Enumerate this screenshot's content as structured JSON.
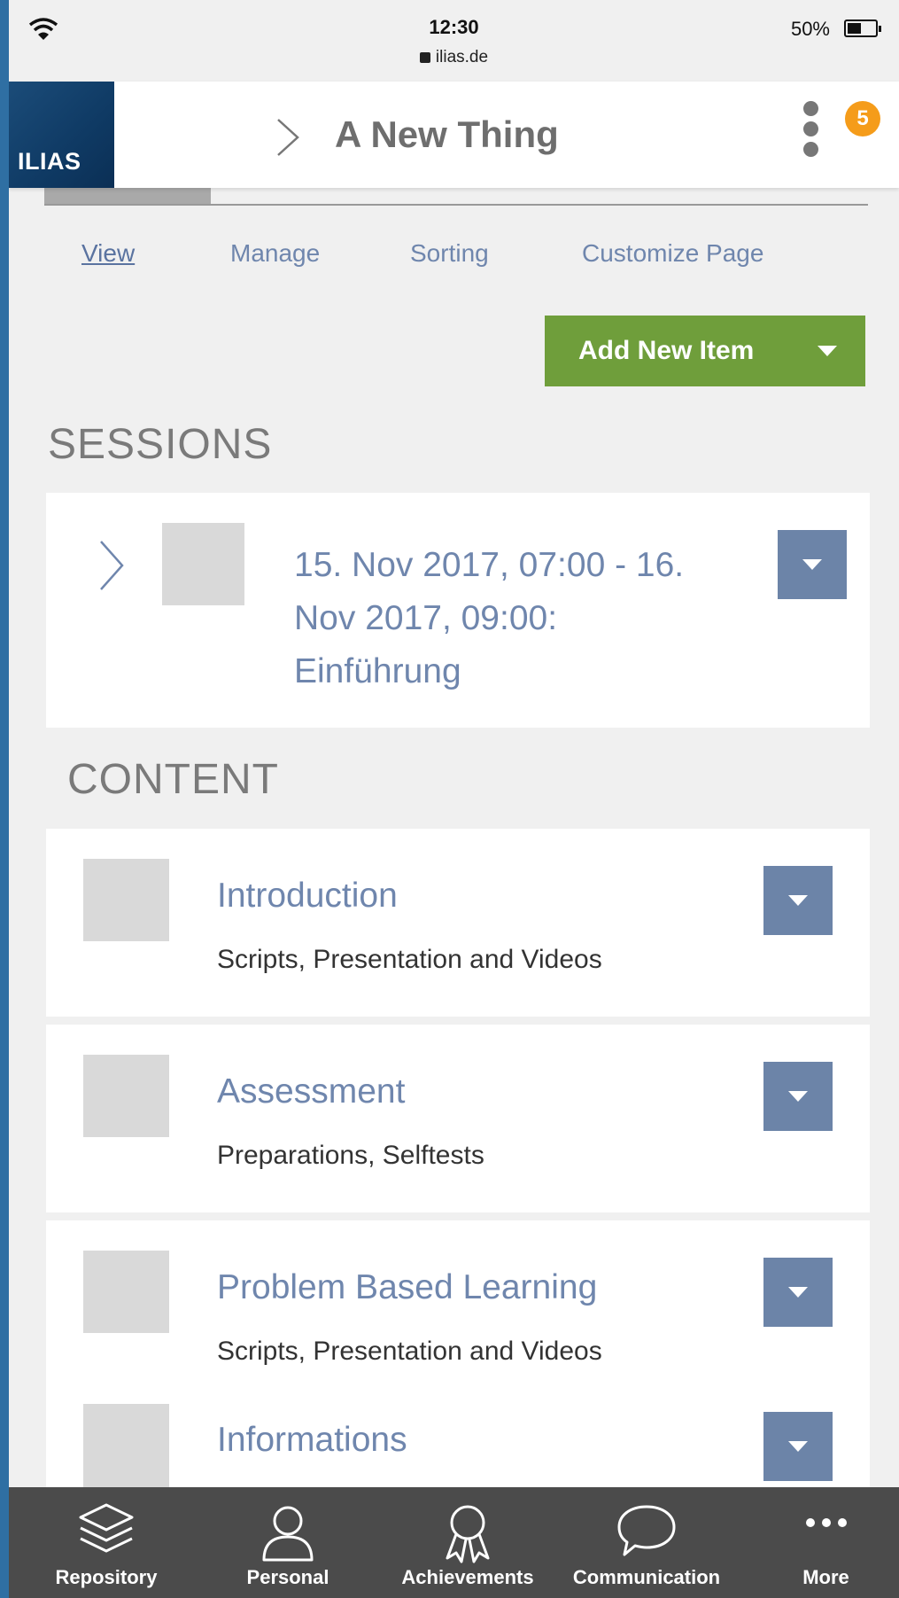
{
  "status_bar": {
    "time": "12:30",
    "url": "ilias.de",
    "battery": "50%"
  },
  "header": {
    "logo": "ILIAS",
    "title": "A New Thing",
    "notification_count": "5"
  },
  "subtabs": [
    "View",
    "Manage",
    "Sorting",
    "Customize Page"
  ],
  "add_button": "Add New Item",
  "sessions": {
    "heading": "SESSIONS",
    "item": {
      "line1": "15. Nov 2017, 07:00 - 16.",
      "line2": "Nov 2017, 09:00:",
      "line3": "Einführung"
    }
  },
  "content": {
    "heading": "CONTENT",
    "items": [
      {
        "title": "Introduction",
        "desc": "Scripts, Presentation and Videos"
      },
      {
        "title": "Assessment",
        "desc": "Preparations, Selftests"
      },
      {
        "title": "Problem Based Learning",
        "desc": "Scripts, Presentation and Videos"
      },
      {
        "title": "Informations",
        "desc": ""
      }
    ]
  },
  "bottom_nav": [
    "Repository",
    "Personal",
    "Achievements",
    "Communication",
    "More"
  ],
  "colors": {
    "accent_link": "#6f86ad",
    "add_button": "#6f9e3b",
    "dropdown": "#6c84a8",
    "badge": "#f59c1a",
    "bottom_nav": "#4b4b4b"
  }
}
